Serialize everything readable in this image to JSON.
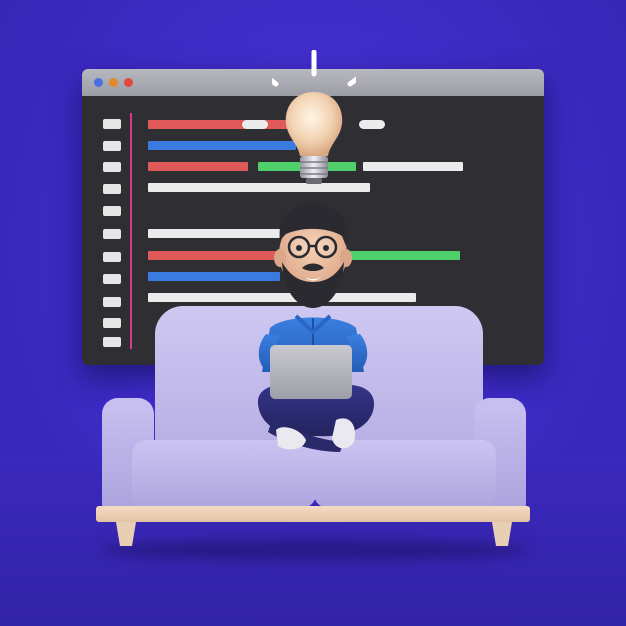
{
  "scene": {
    "background_color": "#3f2cc8",
    "code_window": {
      "titlebar_color": "#a9a9b2",
      "window_dots": [
        {
          "name": "close-dot",
          "color": "#4a6fe0"
        },
        {
          "name": "minimize-dot",
          "color": "#e08a2a"
        },
        {
          "name": "maximize-dot",
          "color": "#e04a3a"
        }
      ],
      "body_color": "#2f2f33",
      "code_bar_colors": {
        "red": "#e05a5a",
        "blue": "#3a7be0",
        "green": "#4fd06a",
        "white": "#ebebeb",
        "gutter": "#d63a8c"
      }
    },
    "lightbulb": {
      "icon": "lightbulb-icon"
    },
    "character": {
      "shirt_color": "#2d6fd1",
      "pants_color": "#2b2a6b",
      "hair_color": "#2a2a30",
      "beard_color": "#2a2a30",
      "device_icon": "laptop-icon"
    },
    "sofa": {
      "upholstery_color": "#c1b9ec",
      "base_color": "#ecd3b8"
    }
  }
}
